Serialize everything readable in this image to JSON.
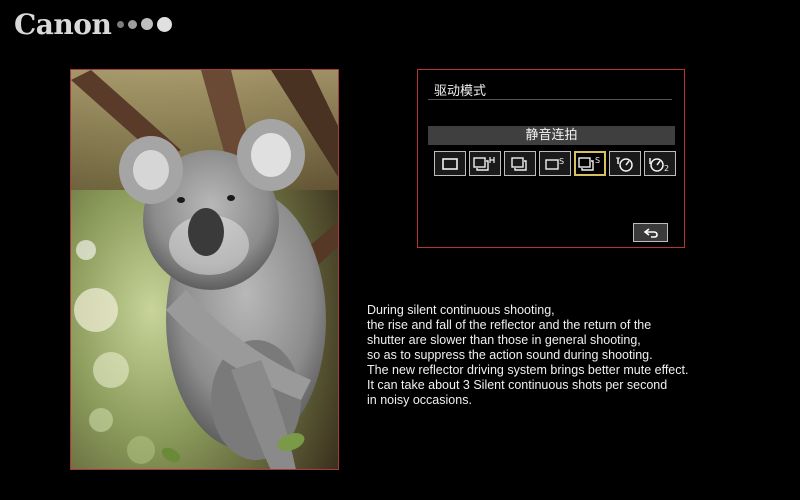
{
  "brand": {
    "name": "Canon",
    "icon": "dots-graphic"
  },
  "photo": {
    "subject": "koala-photo"
  },
  "menu": {
    "title": "驱动模式",
    "selected_mode": "静音连拍",
    "modes": [
      {
        "icon": "single-shot-icon",
        "selected": false
      },
      {
        "icon": "high-speed-continuous-icon",
        "selected": false
      },
      {
        "icon": "low-speed-continuous-icon",
        "selected": false
      },
      {
        "icon": "silent-single-icon",
        "selected": false
      },
      {
        "icon": "silent-continuous-icon",
        "selected": true
      },
      {
        "icon": "self-timer-10s-icon",
        "selected": false
      },
      {
        "icon": "self-timer-2s-icon",
        "selected": false
      }
    ],
    "back_icon": "return-icon"
  },
  "description": {
    "lines": [
      "During silent continuous shooting,",
      "the rise and fall of the reflector and the return of the",
      "shutter are slower than those in general shooting,",
      "so as to suppress the action sound during shooting.",
      "The new reflector driving system brings better mute effect.",
      "It can take about 3 Silent continuous shots per second",
      "in noisy occasions."
    ]
  },
  "colors": {
    "frame": "#b8323a",
    "selection": "#d8c060",
    "background": "#000000"
  }
}
